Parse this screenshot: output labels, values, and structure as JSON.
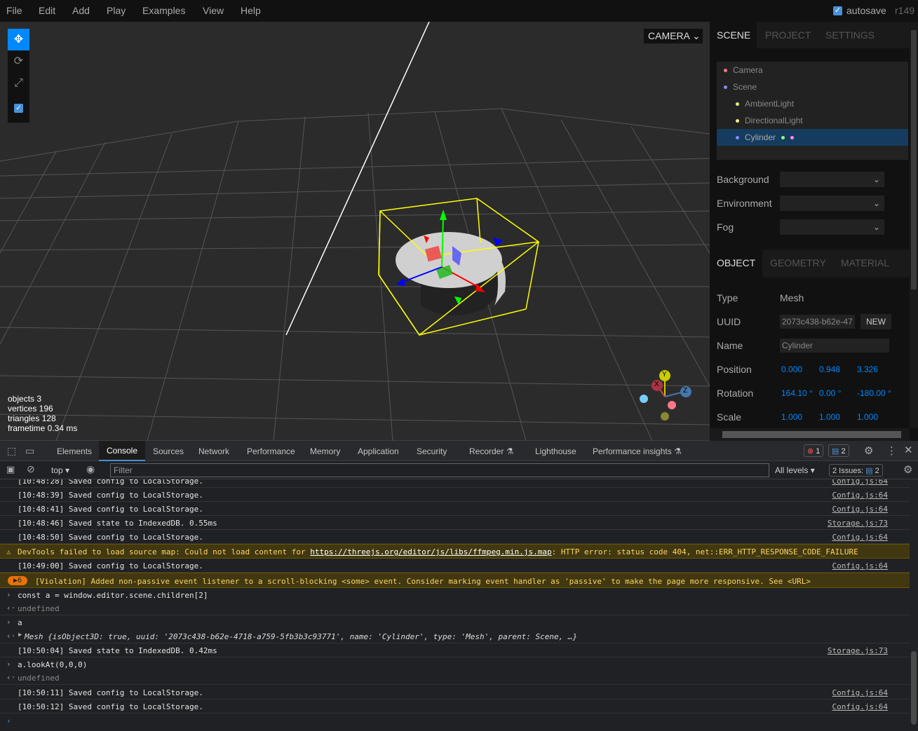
{
  "menubar": {
    "items": [
      "File",
      "Edit",
      "Add",
      "Play",
      "Examples",
      "View",
      "Help"
    ],
    "autosave_label": "autosave",
    "version": "r149",
    "autosave_checked": true
  },
  "viewport": {
    "camera_label": "CAMERA",
    "info": {
      "objects": "objects  3",
      "vertices": "vertices  196",
      "triangles": "triangles  128",
      "frametime": "frametime  0.34 ms"
    },
    "axis_labels": {
      "x": "X",
      "y": "Y",
      "z": "Z"
    },
    "tools": [
      "move-icon",
      "rotate-icon",
      "scale-icon",
      "checkbox-icon"
    ]
  },
  "sidebar": {
    "tabs": [
      "SCENE",
      "PROJECT",
      "SETTINGS"
    ],
    "outliner": [
      {
        "label": "Camera",
        "dot": "#f78"
      },
      {
        "label": "Scene",
        "dot": "#88f"
      },
      {
        "label": "AmbientLight",
        "dot": "#ee8"
      },
      {
        "label": "DirectionalLight",
        "dot": "#ee8"
      },
      {
        "label": "Cylinder",
        "dot": "#88f",
        "selected": true
      }
    ],
    "scene_props": {
      "background": "Background",
      "environment": "Environment",
      "fog": "Fog"
    },
    "object_tabs": [
      "OBJECT",
      "GEOMETRY",
      "MATERIAL"
    ],
    "object": {
      "type_label": "Type",
      "type_value": "Mesh",
      "uuid_label": "UUID",
      "uuid_value": "2073c438-b62e-47",
      "new_label": "NEW",
      "name_label": "Name",
      "name_value": "Cylinder",
      "position_label": "Position",
      "position": [
        "0.000",
        "0.948",
        "3.326"
      ],
      "rotation_label": "Rotation",
      "rotation": [
        "164.10 °",
        "0.00 °",
        "-180.00 °"
      ],
      "scale_label": "Scale",
      "scale": [
        "1.000",
        "1.000",
        "1.000"
      ]
    }
  },
  "devtools": {
    "tabs": [
      "Elements",
      "Console",
      "Sources",
      "Network",
      "Performance",
      "Memory",
      "Application",
      "Security",
      "Recorder",
      "Lighthouse",
      "Performance insights"
    ],
    "error_count": "1",
    "message_count": "2",
    "context": "top",
    "filter_placeholder": "Filter",
    "levels": "All levels",
    "issues_label": "2 Issues:",
    "issues_count": "2",
    "log": [
      {
        "kind": "log",
        "text": "[10:48:28] Saved config to LocalStorage.",
        "src": "Config.js:64"
      },
      {
        "kind": "log",
        "text": "[10:48:39] Saved config to LocalStorage.",
        "src": "Config.js:64"
      },
      {
        "kind": "log",
        "text": "[10:48:41] Saved config to LocalStorage.",
        "src": "Config.js:64"
      },
      {
        "kind": "log",
        "text": "[10:48:46] Saved state to IndexedDB. 0.55ms",
        "src": "Storage.js:73"
      },
      {
        "kind": "log",
        "text": "[10:48:50] Saved config to LocalStorage.",
        "src": "Config.js:64"
      },
      {
        "kind": "warn",
        "prefix": "DevTools failed to load source map: Could not load content for ",
        "link": "https://threejs.org/editor/js/libs/ffmpeg.min.js.map",
        "suffix": ": HTTP error: status code 404, net::ERR_HTTP_RESPONSE_CODE_FAILURE"
      },
      {
        "kind": "log",
        "text": "[10:49:00] Saved config to LocalStorage.",
        "src": "Config.js:64"
      },
      {
        "kind": "violation",
        "count": "6",
        "text": "[Violation] Added non-passive event listener to a scroll-blocking <some> event. Consider marking event handler as 'passive' to make the page more responsive. See <URL>"
      },
      {
        "kind": "input",
        "text": "const a = window.editor.scene.children[2]"
      },
      {
        "kind": "ret",
        "text": "undefined"
      },
      {
        "kind": "input",
        "text": "a"
      },
      {
        "kind": "obj",
        "text": "Mesh {isObject3D: true, uuid: '2073c438-b62e-4718-a759-5fb3b3c93771', name: 'Cylinder', type: 'Mesh', parent: Scene, …}"
      },
      {
        "kind": "log",
        "text": "[10:50:04] Saved state to IndexedDB. 0.42ms",
        "src": "Storage.js:73"
      },
      {
        "kind": "input",
        "text": "a.lookAt(0,0,0)"
      },
      {
        "kind": "ret",
        "text": "undefined"
      },
      {
        "kind": "log",
        "text": "[10:50:11] Saved config to LocalStorage.",
        "src": "Config.js:64"
      },
      {
        "kind": "log",
        "text": "[10:50:12] Saved config to LocalStorage.",
        "src": "Config.js:64"
      }
    ]
  }
}
